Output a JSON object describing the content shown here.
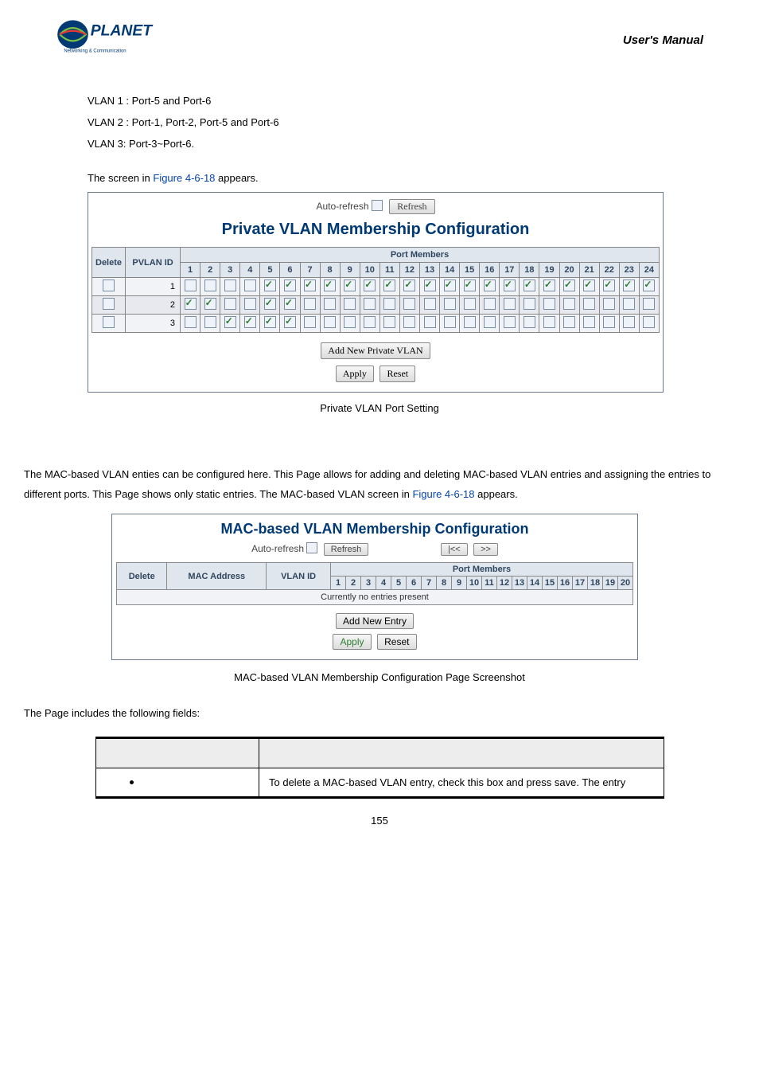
{
  "header": {
    "brand_line1": "PLANET",
    "brand_line2": "Networking & Communication",
    "manual_title": "User's  Manual"
  },
  "intro_lines": [
    "VLAN 1 : Port-5 and Port-6",
    "VLAN 2 : Port-1, Port-2, Port-5 and Port-6",
    "VLAN 3: Port-3~Port-6."
  ],
  "fig_intro_pre": "The screen in ",
  "fig_intro_ref": "Figure 4-6-18",
  "fig_intro_post": " appears.",
  "pvlan": {
    "auto_refresh_label": "Auto-refresh",
    "refresh_btn": "Refresh",
    "title": "Private VLAN Membership Configuration",
    "col_delete": "Delete",
    "col_pvlanid": "PVLAN ID",
    "col_portmembers": "Port Members",
    "port_headers": [
      "1",
      "2",
      "3",
      "4",
      "5",
      "6",
      "7",
      "8",
      "9",
      "10",
      "11",
      "12",
      "13",
      "14",
      "15",
      "16",
      "17",
      "18",
      "19",
      "20",
      "21",
      "22",
      "23",
      "24"
    ],
    "rows": [
      {
        "id": "1",
        "delete": false,
        "ports": [
          false,
          false,
          false,
          false,
          true,
          true,
          true,
          true,
          true,
          true,
          true,
          true,
          true,
          true,
          true,
          true,
          true,
          true,
          true,
          true,
          true,
          true,
          true,
          true
        ]
      },
      {
        "id": "2",
        "delete": false,
        "ports": [
          true,
          true,
          false,
          false,
          true,
          true,
          false,
          false,
          false,
          false,
          false,
          false,
          false,
          false,
          false,
          false,
          false,
          false,
          false,
          false,
          false,
          false,
          false,
          false
        ]
      },
      {
        "id": "3",
        "delete": false,
        "ports": [
          false,
          false,
          true,
          true,
          true,
          true,
          false,
          false,
          false,
          false,
          false,
          false,
          false,
          false,
          false,
          false,
          false,
          false,
          false,
          false,
          false,
          false,
          false,
          false
        ]
      }
    ],
    "add_btn": "Add New Private VLAN",
    "apply_btn": "Apply",
    "reset_btn": "Reset",
    "caption": "Private VLAN Port Setting"
  },
  "mac_para_pre": "The MAC-based VLAN enties can be configured here. This Page allows for adding and deleting MAC-based VLAN entries and assigning the entries to different ports. This Page shows only static entries. The MAC-based VLAN screen in ",
  "mac_para_ref": "Figure 4-6-18",
  "mac_para_post": " appears.",
  "mac": {
    "title": "MAC-based VLAN Membership Configuration",
    "auto_refresh_label": "Auto-refresh",
    "refresh_btn": "Refresh",
    "nav_prev": "|<<",
    "nav_next": ">>",
    "col_delete": "Delete",
    "col_mac": "MAC Address",
    "col_vlanid": "VLAN ID",
    "col_portmembers": "Port Members",
    "port_headers": [
      "1",
      "2",
      "3",
      "4",
      "5",
      "6",
      "7",
      "8",
      "9",
      "10",
      "11",
      "12",
      "13",
      "14",
      "15",
      "16",
      "17",
      "18",
      "19",
      "20"
    ],
    "empty_msg": "Currently no entries present",
    "add_btn": "Add New Entry",
    "apply_btn": "Apply",
    "reset_btn": "Reset",
    "caption": "MAC-based VLAN Membership Configuration Page Screenshot"
  },
  "fields_intro": "The Page includes the following fields:",
  "fields_table": {
    "row1_desc": "To delete a MAC-based VLAN entry, check this box and press save. The entry"
  },
  "page_number": "155"
}
